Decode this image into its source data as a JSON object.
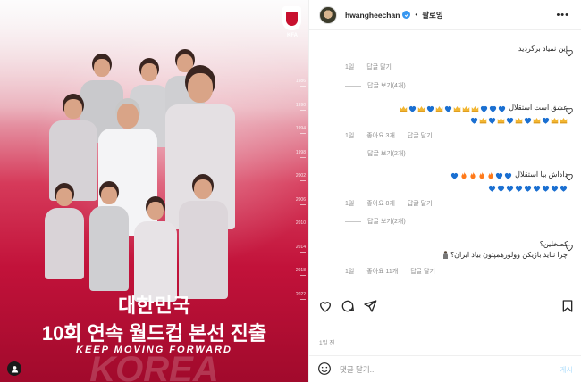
{
  "post": {
    "poster": {
      "emblem_label": "KFA",
      "years": [
        "1986",
        "1990",
        "1994",
        "1998",
        "2002",
        "2006",
        "2010",
        "2014",
        "2018",
        "2022"
      ],
      "title_line1": "대한민국",
      "title_line2": "10회 연속 월드컵 본선 진출",
      "tagline": "KEEP MOVING FORWARD",
      "ghost_text": "KOREA"
    },
    "header": {
      "username": "hwangheechan",
      "separator": "•",
      "follow_label": "팔로잉",
      "more_label": "•••"
    },
    "comments": [
      {
        "text": "این نمیاد برگردید",
        "meta": [
          "1일",
          "답글 달기"
        ],
        "replies_label": "답글 보기(4개)"
      },
      {
        "text_line1": "عشق است استقلال",
        "line1_emoji": [
          "heart",
          "heart",
          "heart",
          "crown",
          "crown",
          "crown",
          "heart",
          "crown",
          "heart",
          "crown",
          "heart",
          "crown"
        ],
        "line2_emoji": [
          "crown",
          "crown",
          "heart",
          "crown",
          "heart",
          "crown",
          "heart",
          "crown",
          "heart",
          "crown",
          "heart"
        ],
        "meta": [
          "1일",
          "좋아요 3개",
          "답글 달기"
        ],
        "replies_label": "답글 보기(2개)"
      },
      {
        "text": "داداش بیا استقلال",
        "line1_emoji": [
          "heart",
          "heart",
          "fire",
          "fire",
          "fire",
          "fire",
          "heart"
        ],
        "line2_emoji": [
          "heart",
          "heart",
          "heart",
          "heart",
          "heart",
          "heart",
          "heart",
          "heart",
          "heart"
        ],
        "meta": [
          "1일",
          "좋아요 8개",
          "답글 달기"
        ],
        "replies_label": "답글 보기(2개)"
      },
      {
        "text_line1": "کصخلین؟",
        "text_line2": "چرا نباید بازیکن وولورهمپتون بیاد ایران؟",
        "meta": [
          "1일",
          "좋아요 11개",
          "답글 달기"
        ]
      }
    ],
    "timestamp": "1일 전",
    "composer": {
      "placeholder": "댓글 달기...",
      "post_label": "게시"
    },
    "colors": {
      "poster_red": "#c2123a",
      "verified_blue": "#3897f0",
      "heart_blue": "#1a6fd1",
      "crown_gold": "#f2b632",
      "fire_orange": "#ff7a1a",
      "muted_text": "#8e8e8e",
      "post_button": "#b2dffc"
    },
    "icons": [
      "kfa-emblem-icon",
      "verified-badge-icon",
      "heart-icon",
      "comment-icon",
      "share-icon",
      "save-icon",
      "emoji-icon",
      "user-tag-icon"
    ]
  }
}
